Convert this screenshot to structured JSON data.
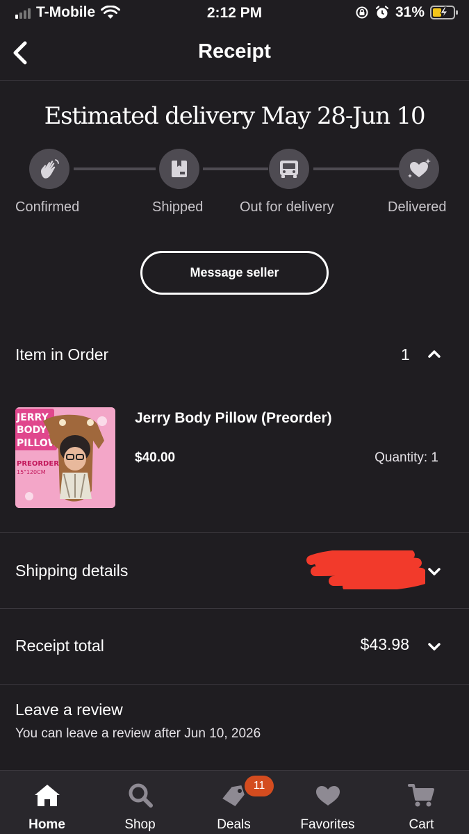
{
  "status_bar": {
    "carrier": "T-Mobile",
    "time": "2:12 PM",
    "battery_percent": "31%"
  },
  "header": {
    "title": "Receipt",
    "back_icon": "chevron-left-icon"
  },
  "delivery": {
    "heading": "Estimated delivery May 28-Jun 10",
    "steps": [
      {
        "label": "Confirmed",
        "icon": "waving-hand-icon"
      },
      {
        "label": "Shipped",
        "icon": "package-icon"
      },
      {
        "label": "Out for delivery",
        "icon": "truck-icon"
      },
      {
        "label": "Delivered",
        "icon": "heart-sparkle-icon"
      }
    ]
  },
  "actions": {
    "message_seller": "Message seller"
  },
  "order": {
    "section_label": "Item in Order",
    "count": "1",
    "item": {
      "name": "Jerry Body Pillow (Preorder)",
      "price": "$40.00",
      "quantity": "Quantity: 1",
      "thumb_text": [
        "JERRY",
        "BODY",
        "PILLOW",
        "PREORDER",
        "15\"120CM"
      ]
    }
  },
  "shipping": {
    "label": "Shipping details"
  },
  "receipt_total": {
    "label": "Receipt total",
    "value": "$43.98"
  },
  "review": {
    "title": "Leave a review",
    "subtitle": "You can leave a review after Jun 10, 2026"
  },
  "tabs": [
    {
      "label": "Home",
      "icon": "home-icon",
      "active": true
    },
    {
      "label": "Shop",
      "icon": "search-icon"
    },
    {
      "label": "Deals",
      "icon": "tag-icon",
      "badge": "11"
    },
    {
      "label": "Favorites",
      "icon": "heart-icon"
    },
    {
      "label": "Cart",
      "icon": "cart-icon"
    }
  ],
  "colors": {
    "background": "#1f1d21",
    "step_circle": "#4e4b52",
    "badge": "#d44c1f",
    "redaction": "#f23a2b"
  }
}
